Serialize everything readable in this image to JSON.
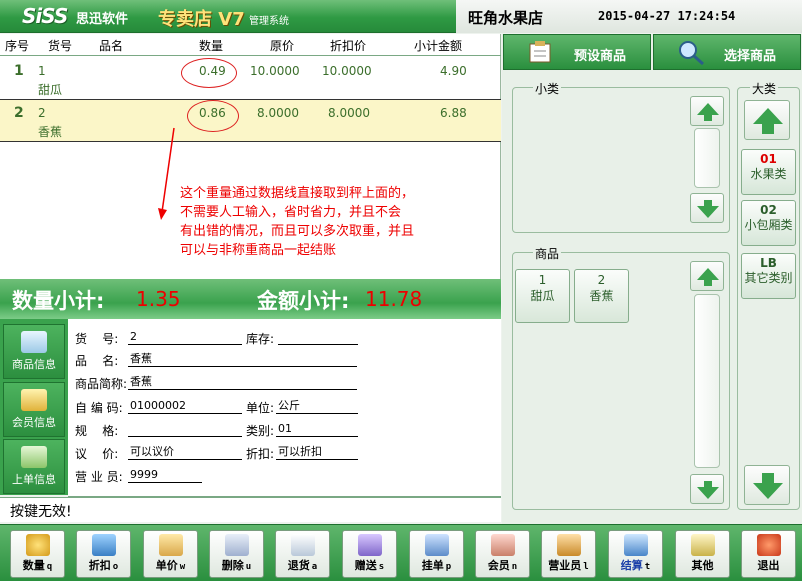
{
  "header": {
    "logo": "SiSS",
    "brand": "思迅软件",
    "edition": "专卖店 V7",
    "subsystem": "管理系统",
    "store_name": "旺角水果店",
    "datetime": "2015-04-27 17:24:54"
  },
  "sales_table": {
    "columns": [
      "序号",
      "货号",
      "品名",
      "数量",
      "原价",
      "折扣价",
      "小计金额"
    ],
    "rows": [
      {
        "seq": "1",
        "code": "1",
        "name": "甜瓜",
        "qty": "0.49",
        "price": "10.0000",
        "disc_price": "10.0000",
        "subtotal": "4.90",
        "selected": false
      },
      {
        "seq": "2",
        "code": "2",
        "name": "香蕉",
        "qty": "0.86",
        "price": "8.0000",
        "disc_price": "8.0000",
        "subtotal": "6.88",
        "selected": true
      }
    ]
  },
  "annotation": {
    "line1": "这个重量通过数据线直接取到秤上面的，",
    "line2": "不需要人工输入，省时省力，并且不会",
    "line3": "有出错的情况，而且可以多次取重，并且",
    "line4": "可以与非称重商品一起结账"
  },
  "totals": {
    "qty_label": "数量小计:",
    "qty_value": "1.35",
    "amount_label": "金额小计:",
    "amount_value": "11.78"
  },
  "side_tabs": [
    {
      "label": "商品信息"
    },
    {
      "label": "会员信息"
    },
    {
      "label": "上单信息"
    }
  ],
  "product_info": {
    "code_label": "货    号:",
    "code_value": "2",
    "stock_label": "库存:",
    "stock_value": "",
    "name_label": "品    名:",
    "name_value": "香蕉",
    "short_label": "商品简称:",
    "short_value": "香蕉",
    "selfcode_label": "自 编 码:",
    "selfcode_value": "01000002",
    "unit_label": "单位:",
    "unit_value": "公斤",
    "spec_label": "规    格:",
    "spec_value": "",
    "category_label": "类别:",
    "category_value": "01",
    "bargain_label": "议    价:",
    "bargain_value": "可以议价",
    "discount_label": "折扣:",
    "discount_value": "可以折扣",
    "clerk_label": "营 业 员:",
    "clerk_value": "9999"
  },
  "status": {
    "message": "按键无效!"
  },
  "right_panel": {
    "preset_button": "预设商品",
    "select_button": "选择商品",
    "subcategory_label": "小类",
    "goods_label": "商品",
    "category_label": "大类",
    "goods": [
      {
        "code": "1",
        "name": "甜瓜"
      },
      {
        "code": "2",
        "name": "香蕉"
      }
    ],
    "categories": [
      {
        "code": "01",
        "name": "水果类",
        "active": true
      },
      {
        "code": "02",
        "name": "小包厢类",
        "active": false
      },
      {
        "code": "LB",
        "name": "其它类别",
        "active": false
      }
    ]
  },
  "toolbar": [
    {
      "label": "数量",
      "key": "q",
      "icon": "coins-icon"
    },
    {
      "label": "折扣",
      "key": "o",
      "icon": "discount-icon"
    },
    {
      "label": "单价",
      "key": "w",
      "icon": "price-icon"
    },
    {
      "label": "删除",
      "key": "u",
      "icon": "delete-icon"
    },
    {
      "label": "退货",
      "key": "a",
      "icon": "return-icon"
    },
    {
      "label": "赠送",
      "key": "s",
      "icon": "gift-icon"
    },
    {
      "label": "挂单",
      "key": "p",
      "icon": "hold-order-icon"
    },
    {
      "label": "会员",
      "key": "n",
      "icon": "member-icon"
    },
    {
      "label": "营业员",
      "key": "l",
      "icon": "clerk-icon"
    },
    {
      "label": "结算",
      "key": "t",
      "icon": "checkout-icon"
    },
    {
      "label": "其他",
      "key": "",
      "icon": "other-icon"
    },
    {
      "label": "退出",
      "key": "",
      "icon": "exit-icon"
    }
  ],
  "colors": {
    "brand_green": "#2f9a44",
    "highlight_red": "#e00000",
    "selected_row": "#fbf6c8"
  }
}
